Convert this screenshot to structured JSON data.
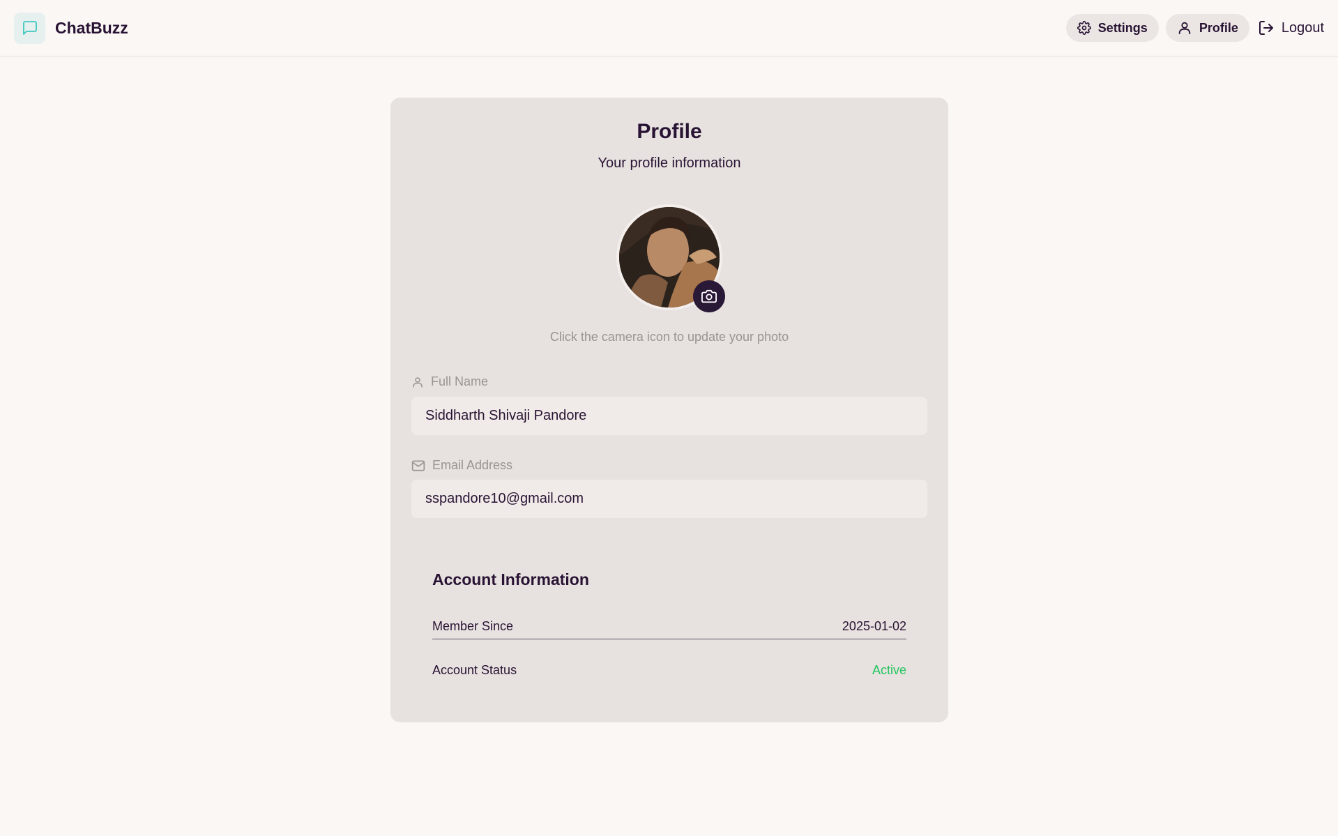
{
  "header": {
    "brand_name": "ChatBuzz",
    "nav": {
      "settings_label": "Settings",
      "profile_label": "Profile",
      "logout_label": "Logout"
    }
  },
  "profile": {
    "title": "Profile",
    "subtitle": "Your profile information",
    "avatar_hint": "Click the camera icon to update your photo",
    "full_name": {
      "label": "Full Name",
      "value": "Siddharth Shivaji Pandore"
    },
    "email": {
      "label": "Email Address",
      "value": "sspandore10@gmail.com"
    }
  },
  "account": {
    "title": "Account Information",
    "rows": [
      {
        "label": "Member Since",
        "value": "2025-01-02"
      },
      {
        "label": "Account Status",
        "value": "Active"
      }
    ]
  },
  "colors": {
    "background": "#faf7f5",
    "card": "#e7e2df",
    "primary_text": "#291334",
    "muted_text": "#9a9491",
    "status_active": "#22c55e",
    "camera_button": "#2a1837"
  },
  "icons": {
    "brand": "message-square-icon",
    "settings": "gear-icon",
    "profile": "user-icon",
    "logout": "logout-icon",
    "camera": "camera-icon",
    "full_name": "user-icon",
    "email": "mail-icon"
  }
}
